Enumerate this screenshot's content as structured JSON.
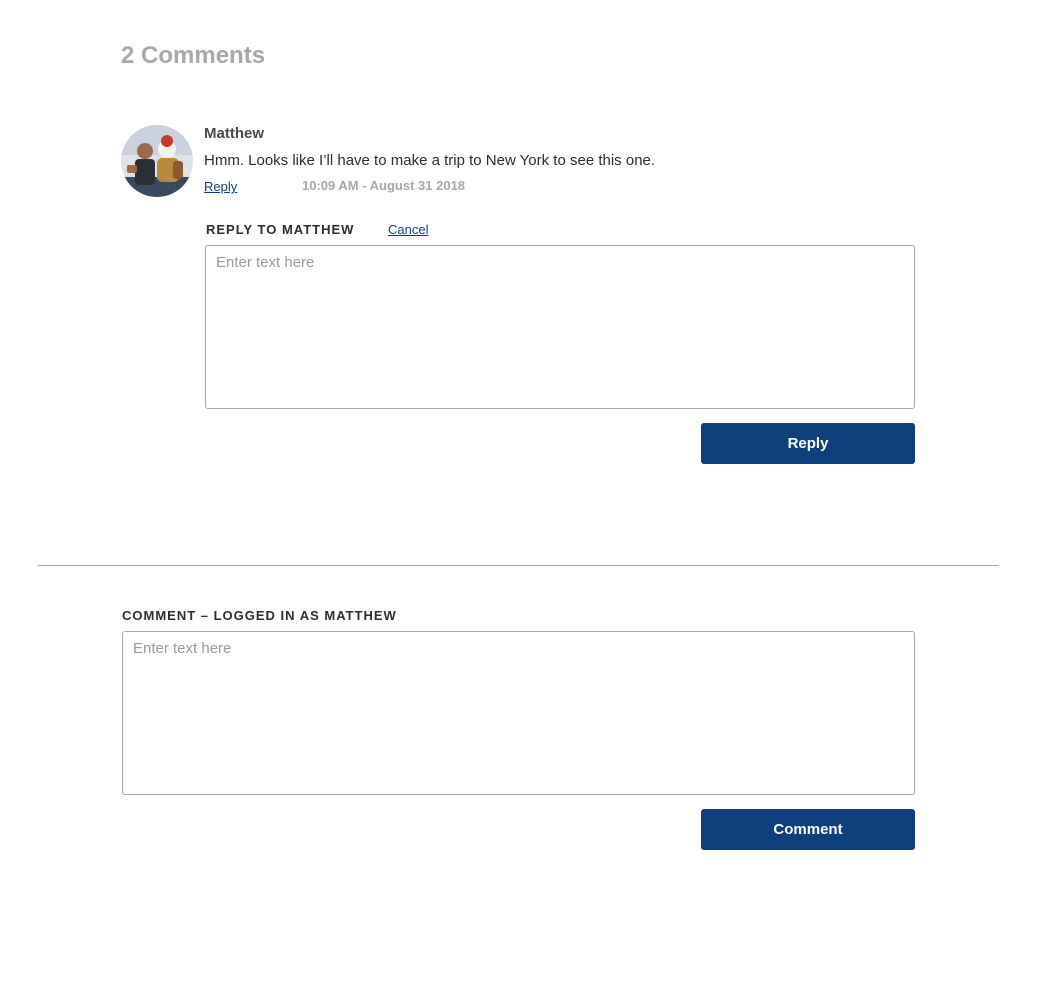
{
  "comments_section": {
    "title": "2 Comments"
  },
  "comment": {
    "author": "Matthew",
    "text": "Hmm. Looks like I’ll have to make a trip to New York to see this one.",
    "reply_label": "Reply",
    "timestamp": "10:09 AM - August 31 2018",
    "avatar_icon": "user-avatar-photo"
  },
  "reply_form": {
    "heading": "REPLY TO MATTHEW",
    "cancel_label": "Cancel",
    "placeholder": "Enter text here",
    "value": "",
    "submit_label": "Reply"
  },
  "comment_form": {
    "heading": "COMMENT – LOGGED IN AS MATTHEW",
    "placeholder": "Enter text here",
    "value": "",
    "submit_label": "Comment"
  },
  "colors": {
    "accent": "#0e3f7a",
    "muted_text": "#a8a8a8",
    "border": "#a8a8a8",
    "text": "#2d2d2d"
  }
}
